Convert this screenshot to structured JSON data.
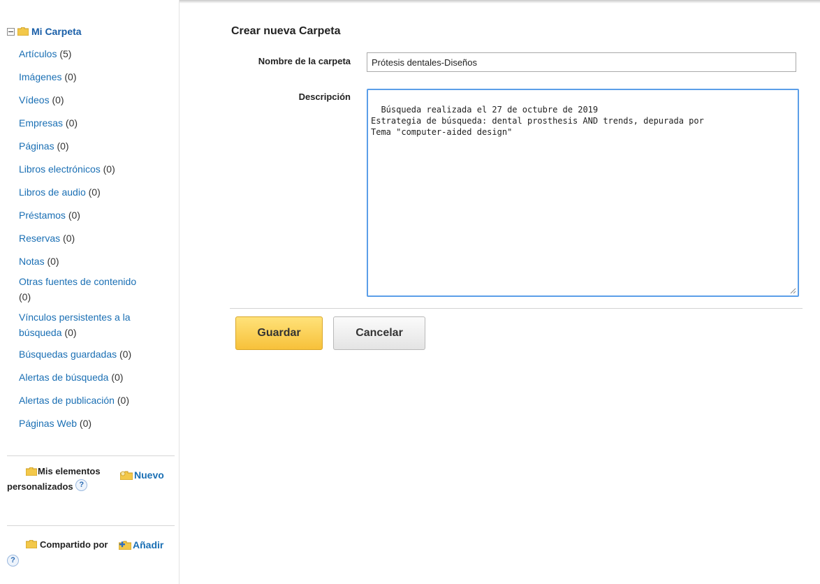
{
  "sidebar": {
    "root_label": "Mi Carpeta",
    "items": [
      {
        "label": "Artículos",
        "count": "(5)"
      },
      {
        "label": "Imágenes",
        "count": "(0)"
      },
      {
        "label": "Vídeos",
        "count": "(0)"
      },
      {
        "label": "Empresas",
        "count": "(0)"
      },
      {
        "label": "Páginas",
        "count": "(0)"
      },
      {
        "label": "Libros electrónicos",
        "count": "(0)"
      },
      {
        "label": "Libros de audio",
        "count": "(0)"
      },
      {
        "label": "Préstamos",
        "count": "(0)"
      },
      {
        "label": "Reservas",
        "count": "(0)"
      },
      {
        "label": "Notas",
        "count": "(0)"
      },
      {
        "label": "Otras fuentes de contenido",
        "count": "(0)"
      },
      {
        "label": "Vínculos persistentes a la búsqueda",
        "count": "(0)"
      },
      {
        "label": "Búsquedas guardadas",
        "count": "(0)"
      },
      {
        "label": "Alertas de búsqueda",
        "count": "(0)"
      },
      {
        "label": "Alertas de publicación",
        "count": "(0)"
      },
      {
        "label": "Páginas Web",
        "count": "(0)"
      }
    ],
    "custom_section": {
      "title": "Mis elementos personalizados",
      "new_label": "Nuevo",
      "help": "?"
    },
    "shared_section": {
      "title": "Compartido por",
      "add_label": "Añadir",
      "help": "?"
    }
  },
  "form": {
    "heading": "Crear nueva Carpeta",
    "name_label": "Nombre de la carpeta",
    "name_value": "Prótesis dentales-Diseños",
    "desc_label": "Descripción",
    "desc_value": "Búsqueda realizada el 27 de octubre de 2019\nEstrategia de búsqueda: dental prosthesis AND trends, depurada por\nTema \"computer-aided design\"",
    "save_label": "Guardar",
    "cancel_label": "Cancelar"
  },
  "colors": {
    "link": "#1a6fb4",
    "save_button": "#f7c13a",
    "focus_border": "#5b9ee8"
  }
}
